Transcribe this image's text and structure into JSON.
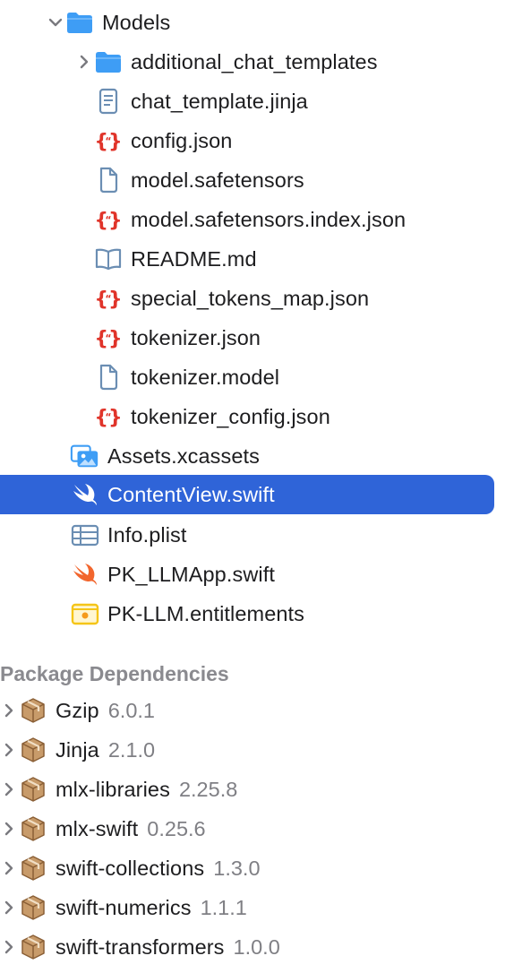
{
  "navigator": {
    "models_folder": {
      "label": "Models",
      "icon": "folder-icon",
      "expanded": true
    },
    "models_children": [
      {
        "label": "additional_chat_templates",
        "icon": "folder-icon",
        "collapsed": true
      },
      {
        "label": "chat_template.jinja",
        "icon": "text-document-icon"
      },
      {
        "label": "config.json",
        "icon": "json-braces-icon"
      },
      {
        "label": "model.safetensors",
        "icon": "document-icon"
      },
      {
        "label": "model.safetensors.index.json",
        "icon": "json-braces-icon"
      },
      {
        "label": "README.md",
        "icon": "book-icon"
      },
      {
        "label": "special_tokens_map.json",
        "icon": "json-braces-icon"
      },
      {
        "label": "tokenizer.json",
        "icon": "json-braces-icon"
      },
      {
        "label": "tokenizer.model",
        "icon": "document-icon"
      },
      {
        "label": "tokenizer_config.json",
        "icon": "json-braces-icon"
      }
    ],
    "project_files": [
      {
        "label": "Assets.xcassets",
        "icon": "asset-catalog-icon"
      },
      {
        "label": "ContentView.swift",
        "icon": "swift-icon",
        "selected": true
      },
      {
        "label": "Info.plist",
        "icon": "plist-table-icon"
      },
      {
        "label": "PK_LLMApp.swift",
        "icon": "swift-icon"
      },
      {
        "label": "PK-LLM.entitlements",
        "icon": "entitlements-icon"
      }
    ]
  },
  "package_dependencies": {
    "title": "Package Dependencies",
    "items": [
      {
        "name": "Gzip",
        "version": "6.0.1"
      },
      {
        "name": "Jinja",
        "version": "2.1.0"
      },
      {
        "name": "mlx-libraries",
        "version": "2.25.8"
      },
      {
        "name": "mlx-swift",
        "version": "0.25.6"
      },
      {
        "name": "swift-collections",
        "version": "1.3.0"
      },
      {
        "name": "swift-numerics",
        "version": "1.1.1"
      },
      {
        "name": "swift-transformers",
        "version": "1.0.0"
      }
    ]
  },
  "colors": {
    "selection": "#2f64d8",
    "folder": "#3e9df5",
    "json_braces": "#e0342a",
    "swift_orange": "#f2662e",
    "icon_outline": "#6b8eb3",
    "package_brown": "#a67c52",
    "entitlements": "#f5c518"
  }
}
